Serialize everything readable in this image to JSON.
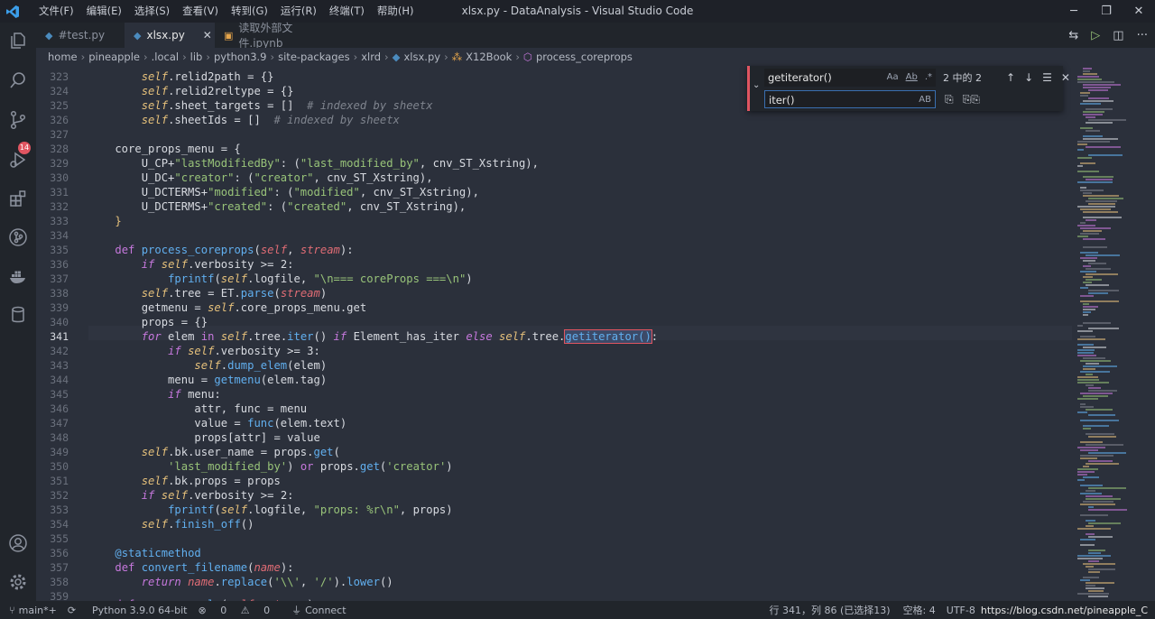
{
  "app": {
    "title": "xlsx.py - DataAnalysis - Visual Studio Code",
    "menu": [
      "文件(F)",
      "编辑(E)",
      "选择(S)",
      "查看(V)",
      "转到(G)",
      "运行(R)",
      "终端(T)",
      "帮助(H)"
    ]
  },
  "tabs": [
    {
      "label": "#test.py",
      "active": false
    },
    {
      "label": "xlsx.py",
      "active": true
    },
    {
      "label": "读取外部文件.ipynb",
      "active": false
    }
  ],
  "breadcrumb": [
    "home",
    "pineapple",
    ".local",
    "lib",
    "python3.9",
    "site-packages",
    "xlrd",
    "xlsx.py",
    "X12Book",
    "process_coreprops"
  ],
  "activity": {
    "scm_badge": "14"
  },
  "find": {
    "search_value": "getiterator()",
    "replace_value": "iter()",
    "result_count": "2 中的 2",
    "opt_case": "Aa",
    "opt_word": "Ab",
    "opt_regex": ".*",
    "opt_preserve": "AB"
  },
  "editor": {
    "line_numbers": [
      "323",
      "324",
      "325",
      "326",
      "327",
      "328",
      "329",
      "330",
      "331",
      "332",
      "333",
      "334",
      "335",
      "336",
      "337",
      "338",
      "339",
      "340",
      "341",
      "342",
      "343",
      "344",
      "345",
      "346",
      "347",
      "348",
      "349",
      "350",
      "351",
      "352",
      "353",
      "354",
      "355",
      "356",
      "357",
      "358",
      "359"
    ]
  },
  "status": {
    "branch": "main*+",
    "python": "Python 3.9.0 64-bit",
    "errors": "0",
    "warnings": "0",
    "connect": "Connect",
    "cursor": "行 341，列 86 (已选择13)",
    "spaces": "空格: 4",
    "encoding": "UTF-8",
    "watermark": "https://blog.csdn.net/pineapple_C"
  }
}
